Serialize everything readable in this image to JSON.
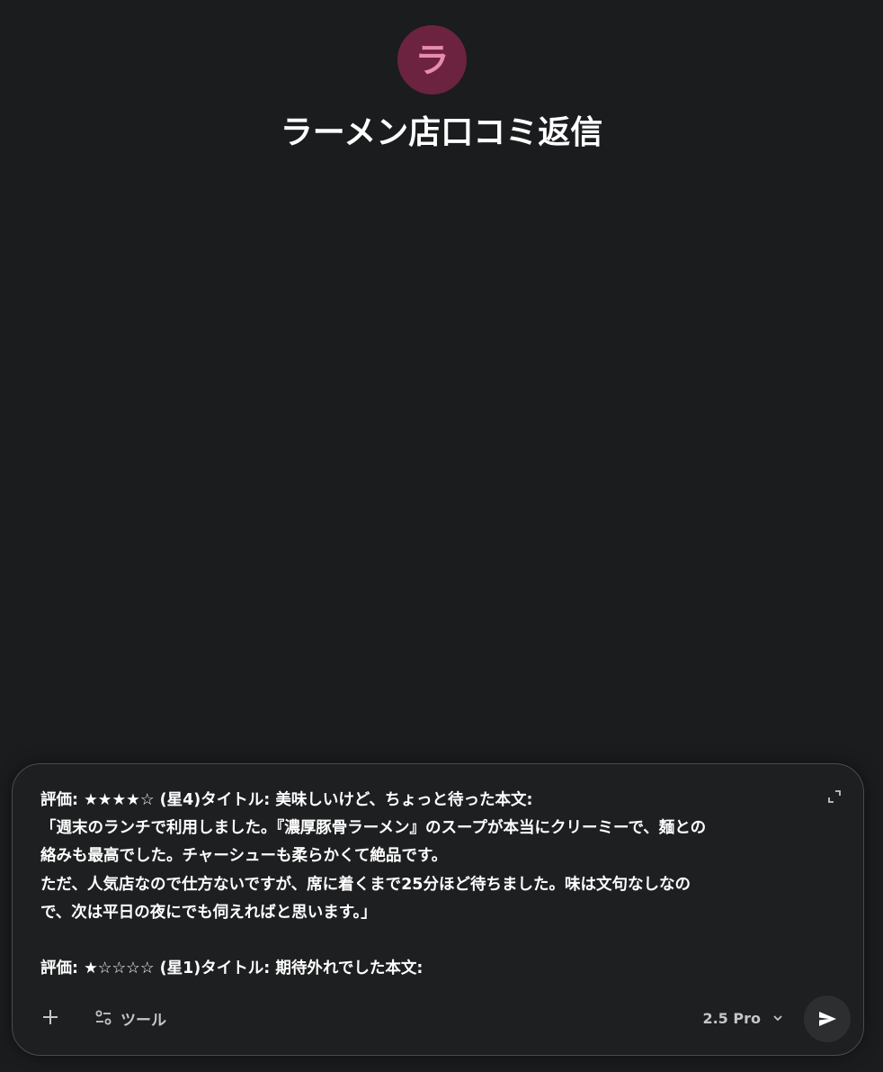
{
  "app": {
    "avatar_letter": "ラ",
    "title": "ラーメン店口コミ返信",
    "avatar_color": "#6b2340",
    "avatar_letter_color": "#e98bb0"
  },
  "composer": {
    "lines": [
      "評価: ★★★★☆ (星4)タイトル: 美味しいけど、ちょっと待った本文:",
      "「週末のランチで利用しました。『濃厚豚骨ラーメン』のスープが本当にクリーミーで、麺との",
      "絡みも最高でした。チャーシューも柔らかくて絶品です。",
      "ただ、人気店なので仕方ないですが、席に着くまで25分ほど待ちました。味は文句なしなの",
      "で、次は平日の夜にでも伺えればと思います。」",
      "",
      "評価: ★☆☆☆☆ (星1)タイトル: 期待外れでした本文:"
    ],
    "expand_icon": "expand-icon"
  },
  "toolbar": {
    "add_icon": "plus-icon",
    "tools_icon": "tune-icon",
    "tools_label": "ツール",
    "model_label": "2.5 Pro",
    "model_dropdown_icon": "chevron-down-icon",
    "send_icon": "send-icon"
  }
}
